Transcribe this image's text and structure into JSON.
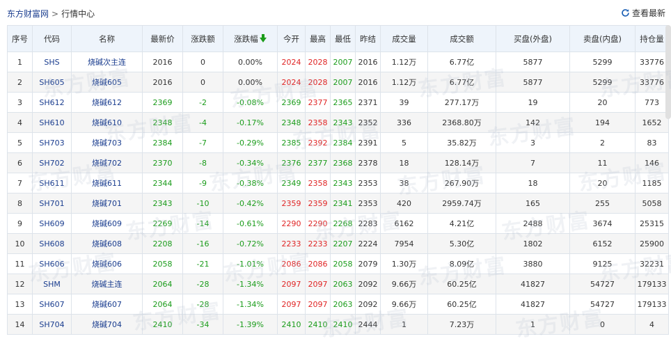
{
  "breadcrumb": {
    "home": "东方财富网",
    "separator": ">",
    "current": "行情中心"
  },
  "refresh_label": "查看最新",
  "watermark_text": "东方财富",
  "columns": [
    "序号",
    "代码",
    "名称",
    "最新价",
    "涨跌额",
    "涨跌幅",
    "今开",
    "最高",
    "最低",
    "昨结",
    "成交量",
    "成交额",
    "买盘(外盘)",
    "卖盘(内盘)",
    "持仓量"
  ],
  "sort_column": "涨跌幅",
  "rows": [
    {
      "no": "1",
      "code": "SHS",
      "name": "烧碱次主连",
      "price": "2016",
      "chg": "0",
      "pct": "0.00%",
      "open": "2024",
      "high": "2028",
      "low": "2007",
      "prev": "2016",
      "vol": "1.12万",
      "amt": "6.77亿",
      "buy": "5877",
      "sell": "5299",
      "oi": "33776",
      "dir": "flat",
      "open_dir": "up",
      "high_dir": "up",
      "low_dir": "down"
    },
    {
      "no": "2",
      "code": "SH605",
      "name": "烧碱605",
      "price": "2016",
      "chg": "0",
      "pct": "0.00%",
      "open": "2024",
      "high": "2028",
      "low": "2007",
      "prev": "2016",
      "vol": "1.12万",
      "amt": "6.77亿",
      "buy": "5877",
      "sell": "5299",
      "oi": "33776",
      "dir": "flat",
      "open_dir": "up",
      "high_dir": "up",
      "low_dir": "down"
    },
    {
      "no": "3",
      "code": "SH612",
      "name": "烧碱612",
      "price": "2369",
      "chg": "-2",
      "pct": "-0.08%",
      "open": "2369",
      "high": "2377",
      "low": "2365",
      "prev": "2371",
      "vol": "39",
      "amt": "277.17万",
      "buy": "19",
      "sell": "20",
      "oi": "773",
      "dir": "down",
      "open_dir": "down",
      "high_dir": "up",
      "low_dir": "down"
    },
    {
      "no": "4",
      "code": "SH610",
      "name": "烧碱610",
      "price": "2348",
      "chg": "-4",
      "pct": "-0.17%",
      "open": "2348",
      "high": "2358",
      "low": "2343",
      "prev": "2352",
      "vol": "336",
      "amt": "2368.80万",
      "buy": "142",
      "sell": "194",
      "oi": "1652",
      "dir": "down",
      "open_dir": "down",
      "high_dir": "up",
      "low_dir": "down"
    },
    {
      "no": "5",
      "code": "SH703",
      "name": "烧碱703",
      "price": "2384",
      "chg": "-7",
      "pct": "-0.29%",
      "open": "2385",
      "high": "2392",
      "low": "2384",
      "prev": "2391",
      "vol": "5",
      "amt": "35.82万",
      "buy": "3",
      "sell": "2",
      "oi": "83",
      "dir": "down",
      "open_dir": "down",
      "high_dir": "up",
      "low_dir": "down"
    },
    {
      "no": "6",
      "code": "SH702",
      "name": "烧碱702",
      "price": "2370",
      "chg": "-8",
      "pct": "-0.34%",
      "open": "2376",
      "high": "2377",
      "low": "2368",
      "prev": "2378",
      "vol": "18",
      "amt": "128.14万",
      "buy": "7",
      "sell": "11",
      "oi": "146",
      "dir": "down",
      "open_dir": "down",
      "high_dir": "down",
      "low_dir": "down"
    },
    {
      "no": "7",
      "code": "SH611",
      "name": "烧碱611",
      "price": "2344",
      "chg": "-9",
      "pct": "-0.38%",
      "open": "2349",
      "high": "2358",
      "low": "2343",
      "prev": "2353",
      "vol": "38",
      "amt": "267.90万",
      "buy": "18",
      "sell": "20",
      "oi": "1185",
      "dir": "down",
      "open_dir": "down",
      "high_dir": "up",
      "low_dir": "down"
    },
    {
      "no": "8",
      "code": "SH701",
      "name": "烧碱701",
      "price": "2343",
      "chg": "-10",
      "pct": "-0.42%",
      "open": "2359",
      "high": "2359",
      "low": "2341",
      "prev": "2353",
      "vol": "420",
      "amt": "2959.74万",
      "buy": "165",
      "sell": "255",
      "oi": "5058",
      "dir": "down",
      "open_dir": "up",
      "high_dir": "up",
      "low_dir": "down"
    },
    {
      "no": "9",
      "code": "SH609",
      "name": "烧碱609",
      "price": "2269",
      "chg": "-14",
      "pct": "-0.61%",
      "open": "2290",
      "high": "2290",
      "low": "2268",
      "prev": "2283",
      "vol": "6162",
      "amt": "4.21亿",
      "buy": "2488",
      "sell": "3674",
      "oi": "25315",
      "dir": "down",
      "open_dir": "up",
      "high_dir": "up",
      "low_dir": "down"
    },
    {
      "no": "10",
      "code": "SH608",
      "name": "烧碱608",
      "price": "2208",
      "chg": "-16",
      "pct": "-0.72%",
      "open": "2233",
      "high": "2233",
      "low": "2207",
      "prev": "2224",
      "vol": "7954",
      "amt": "5.30亿",
      "buy": "1802",
      "sell": "6152",
      "oi": "25900",
      "dir": "down",
      "open_dir": "up",
      "high_dir": "up",
      "low_dir": "down"
    },
    {
      "no": "11",
      "code": "SH606",
      "name": "烧碱606",
      "price": "2058",
      "chg": "-21",
      "pct": "-1.01%",
      "open": "2086",
      "high": "2086",
      "low": "2058",
      "prev": "2079",
      "vol": "1.30万",
      "amt": "8.09亿",
      "buy": "3880",
      "sell": "9125",
      "oi": "32231",
      "dir": "down",
      "open_dir": "up",
      "high_dir": "up",
      "low_dir": "down"
    },
    {
      "no": "12",
      "code": "SHM",
      "name": "烧碱主连",
      "price": "2064",
      "chg": "-28",
      "pct": "-1.34%",
      "open": "2097",
      "high": "2097",
      "low": "2063",
      "prev": "2092",
      "vol": "9.66万",
      "amt": "60.25亿",
      "buy": "41827",
      "sell": "54727",
      "oi": "179133",
      "dir": "down",
      "open_dir": "up",
      "high_dir": "up",
      "low_dir": "down"
    },
    {
      "no": "13",
      "code": "SH607",
      "name": "烧碱607",
      "price": "2064",
      "chg": "-28",
      "pct": "-1.34%",
      "open": "2097",
      "high": "2097",
      "low": "2063",
      "prev": "2092",
      "vol": "9.66万",
      "amt": "60.25亿",
      "buy": "41827",
      "sell": "54727",
      "oi": "179133",
      "dir": "down",
      "open_dir": "up",
      "high_dir": "up",
      "low_dir": "down"
    },
    {
      "no": "14",
      "code": "SH704",
      "name": "烧碱704",
      "price": "2410",
      "chg": "-34",
      "pct": "-1.39%",
      "open": "2410",
      "high": "2410",
      "low": "2410",
      "prev": "2444",
      "vol": "1",
      "amt": "7.23万",
      "buy": "1",
      "sell": "0",
      "oi": "4",
      "dir": "down",
      "open_dir": "down",
      "high_dir": "down",
      "low_dir": "down"
    }
  ],
  "colors": {
    "up": "#e02525",
    "down": "#1b9c1b",
    "link": "#1a3d8f",
    "header_bg": "#eef4fb"
  },
  "icons": {
    "refresh": "refresh-icon",
    "sort": "sort-desc-arrow-icon"
  }
}
